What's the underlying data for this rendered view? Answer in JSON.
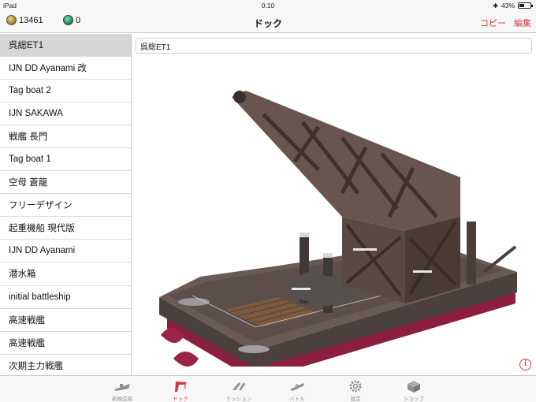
{
  "status": {
    "carrier": "iPad",
    "time": "0:10",
    "battery": "43%",
    "battery_level": 0.43
  },
  "nav": {
    "title": "ドック",
    "coins": "13461",
    "gems": "0",
    "copy_label": "コピー",
    "edit_label": "編集"
  },
  "sidebar": {
    "items": [
      {
        "label": "呉総ET1"
      },
      {
        "label": "IJN DD Ayanami 改"
      },
      {
        "label": "Tag boat 2"
      },
      {
        "label": "IJN SAKAWA"
      },
      {
        "label": "戦艦 長門"
      },
      {
        "label": "Tag boat 1"
      },
      {
        "label": "空母 蒼龍"
      },
      {
        "label": "フリーデザイン"
      },
      {
        "label": "起重機船 現代版"
      },
      {
        "label": "IJN DD Ayanami"
      },
      {
        "label": "潜水箱"
      },
      {
        "label": "initial battleship"
      },
      {
        "label": "高速戦艦"
      },
      {
        "label": "高速戦艦"
      },
      {
        "label": "次期主力戦艦"
      }
    ]
  },
  "main": {
    "ship_name": "呉総ET1",
    "info": "i"
  },
  "tabs": [
    {
      "label": "新規造船",
      "icon": "ship-icon"
    },
    {
      "label": "ドック",
      "icon": "crane-icon"
    },
    {
      "label": "ミッション",
      "icon": "mission-icon"
    },
    {
      "label": "バトル",
      "icon": "battle-icon"
    },
    {
      "label": "設定",
      "icon": "gear-icon"
    },
    {
      "label": "ショップ",
      "icon": "shop-icon"
    }
  ],
  "colors": {
    "accent": "#d23a3a",
    "hull": "#8a1f3f",
    "deck": "#5a4a46"
  }
}
